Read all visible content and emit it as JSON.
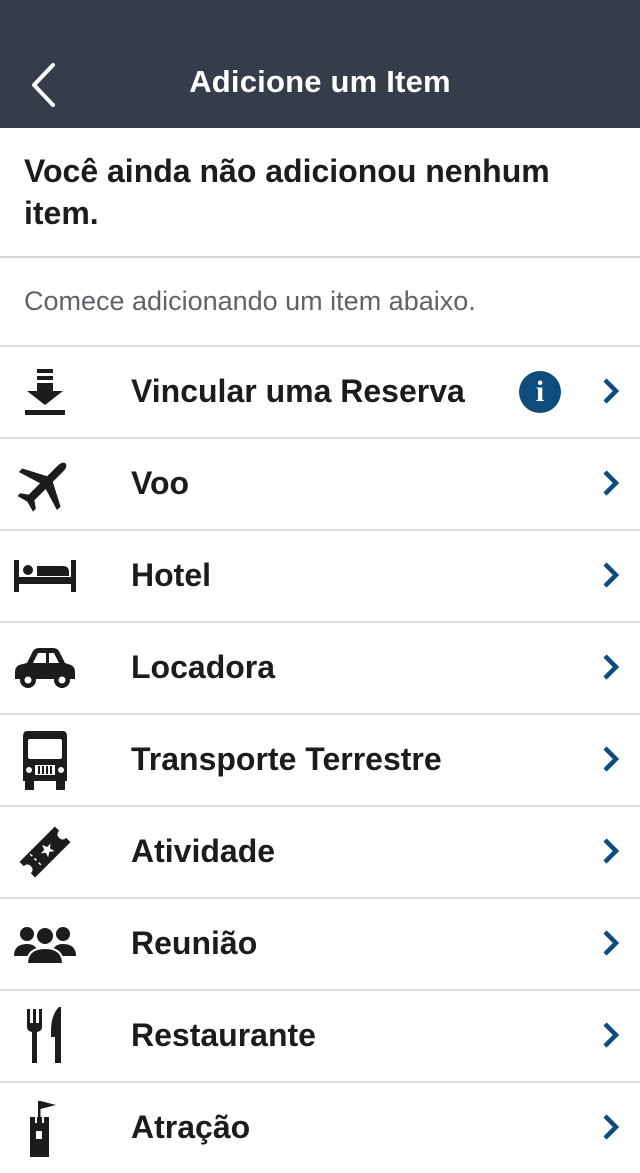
{
  "header": {
    "title": "Adicione um Item",
    "back_icon": "chevron-left-icon"
  },
  "empty_state": {
    "title": "Você ainda não adicionou nenhum item.",
    "hint": "Comece adicionando um item abaixo."
  },
  "info_badge": "i",
  "colors": {
    "header_bg": "#353c4a",
    "accent": "#0e4c7e",
    "icon": "#1c1c1e",
    "separator": "#d4d4d8"
  },
  "items": [
    {
      "label": "Vincular uma Reserva",
      "icon": "download-icon"
    },
    {
      "label": "Voo",
      "icon": "airplane-icon"
    },
    {
      "label": "Hotel",
      "icon": "bed-icon"
    },
    {
      "label": "Locadora",
      "icon": "car-icon"
    },
    {
      "label": "Transporte Terrestre",
      "icon": "bus-icon"
    },
    {
      "label": "Atividade",
      "icon": "ticket-icon"
    },
    {
      "label": "Reunião",
      "icon": "people-icon"
    },
    {
      "label": "Restaurante",
      "icon": "fork-knife-icon"
    },
    {
      "label": "Atração",
      "icon": "castle-icon"
    }
  ]
}
